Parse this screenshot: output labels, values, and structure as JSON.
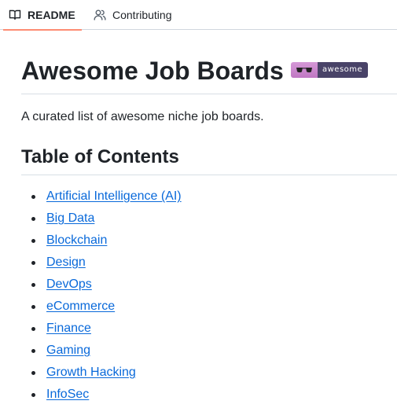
{
  "tabs": {
    "readme": {
      "label": "README",
      "icon": "book-icon"
    },
    "contributing": {
      "label": "Contributing",
      "icon": "people-icon"
    }
  },
  "heading": {
    "title": "Awesome Job Boards",
    "badge": {
      "icon": "sunglasses-icon",
      "text": "awesome",
      "left_color": "#cc87ce",
      "right_color": "#494368"
    }
  },
  "description": "A curated list of awesome niche job boards.",
  "toc": {
    "title": "Table of Contents",
    "items": [
      "Artificial Intelligence (AI)",
      "Big Data",
      "Blockchain",
      "Design",
      "DevOps",
      "eCommerce",
      "Finance",
      "Gaming",
      "Growth Hacking",
      "InfoSec"
    ]
  },
  "colors": {
    "link": "#0969da",
    "active_tab_underline": "#fd8c73",
    "text": "#1f2328",
    "divider": "#d8dee4"
  }
}
